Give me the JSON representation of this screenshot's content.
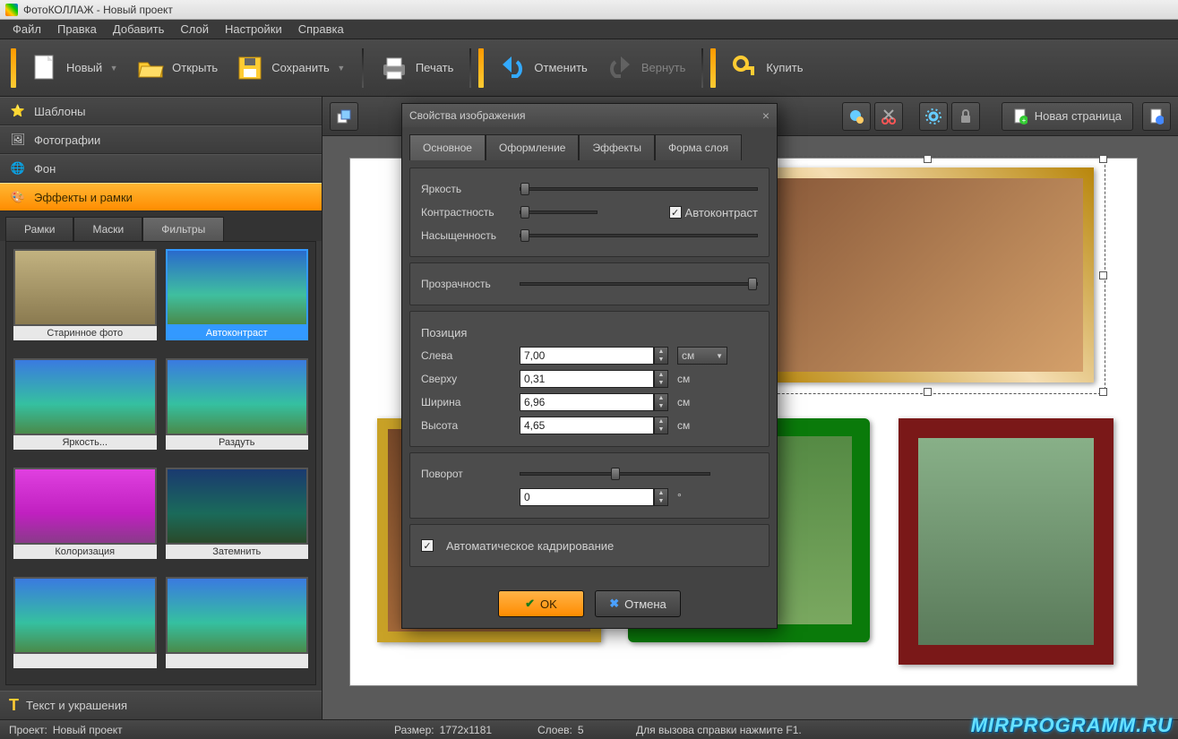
{
  "window": {
    "title": "ФотоКОЛЛАЖ - Новый проект"
  },
  "menu": {
    "file": "Файл",
    "edit": "Правка",
    "add": "Добавить",
    "layer": "Слой",
    "settings": "Настройки",
    "help": "Справка"
  },
  "toolbar": {
    "new": "Новый",
    "open": "Открыть",
    "save": "Сохранить",
    "print": "Печать",
    "undo": "Отменить",
    "redo": "Вернуть",
    "buy": "Купить"
  },
  "sidebar": {
    "items": [
      {
        "label": "Шаблоны"
      },
      {
        "label": "Фотографии"
      },
      {
        "label": "Фон"
      },
      {
        "label": "Эффекты и рамки"
      }
    ],
    "subtabs": {
      "frames": "Рамки",
      "masks": "Маски",
      "filters": "Фильтры"
    },
    "thumbs": [
      {
        "label": "Старинное фото"
      },
      {
        "label": "Автоконтраст"
      },
      {
        "label": "Яркость..."
      },
      {
        "label": "Раздуть"
      },
      {
        "label": "Колоризация"
      },
      {
        "label": "Затемнить"
      }
    ],
    "textdecor": "Текст и украшения"
  },
  "canvastool": {
    "newpage": "Новая страница"
  },
  "dialog": {
    "title": "Свойства изображения",
    "tabs": {
      "main": "Основное",
      "design": "Оформление",
      "effects": "Эффекты",
      "shape": "Форма слоя"
    },
    "brightness": "Яркость",
    "contrast": "Контрастность",
    "saturation": "Насыщенность",
    "autocontrast": "Автоконтраст",
    "opacity": "Прозрачность",
    "position": "Позиция",
    "left": "Слева",
    "left_val": "7,00",
    "top": "Сверху",
    "top_val": "0,31",
    "width": "Ширина",
    "width_val": "6,96",
    "height": "Высота",
    "height_val": "4,65",
    "unit": "см",
    "rotation": "Поворот",
    "rotation_val": "0",
    "rotation_unit": "°",
    "autocrop": "Автоматическое кадрирование",
    "ok": "OK",
    "cancel": "Отмена"
  },
  "status": {
    "project_lbl": "Проект:",
    "project_val": "Новый проект",
    "size_lbl": "Размер:",
    "size_val": "1772x1181",
    "layers_lbl": "Слоев:",
    "layers_val": "5",
    "help": "Для вызова справки нажмите F1."
  },
  "watermark": "MIRPROGRAMM.RU"
}
